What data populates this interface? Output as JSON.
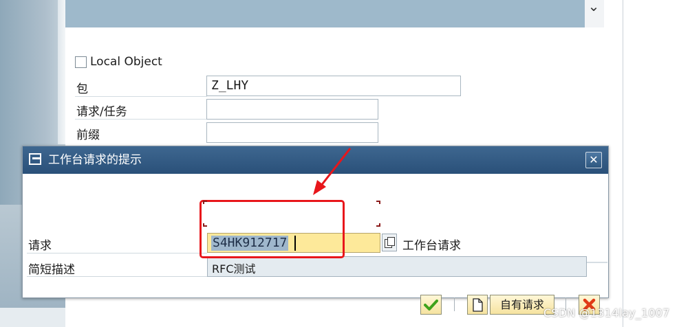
{
  "background_form": {
    "local_object_label": "Local Object",
    "package_label": "包",
    "package_value": "Z_LHY",
    "request_task_label": "请求/任务",
    "request_task_value": "",
    "prefix_label": "前缀",
    "prefix_value": ""
  },
  "dialog": {
    "title": "工作台请求的提示",
    "request_label": "请求",
    "request_value": "S4HK912717",
    "request_type_text": "工作台请求",
    "short_desc_label": "简短描述",
    "short_desc_value": "RFC测试",
    "own_requests_button": "自有请求"
  },
  "watermark": "CSDN @1314lay_1007",
  "colors": {
    "title_bar": "#2f5880",
    "input_highlight": "#fde99a",
    "annotation_red": "#e8161b",
    "confirm_green": "#3ea21c",
    "cancel_red": "#e03a16"
  },
  "icons": [
    "chevron-down-icon",
    "dialog-window-icon",
    "close-icon",
    "search-help-icon",
    "checkmark-icon",
    "new-document-icon",
    "cancel-x-icon"
  ]
}
